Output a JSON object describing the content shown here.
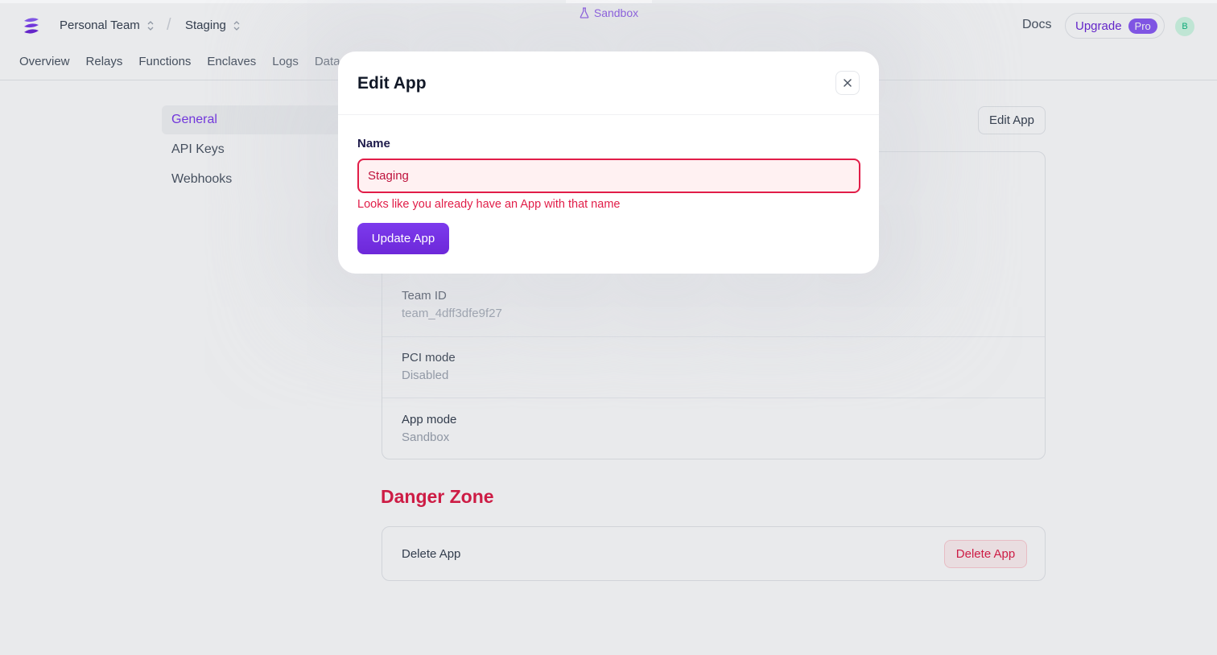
{
  "environment": {
    "label": "Sandbox",
    "icon": "flask-icon"
  },
  "header": {
    "team": "Personal Team",
    "app": "Staging",
    "docs": "Docs",
    "upgrade": "Upgrade",
    "plan_badge": "Pro",
    "avatar_initial": "B"
  },
  "tabs": [
    "Overview",
    "Relays",
    "Functions",
    "Enclaves",
    "Logs",
    "Data"
  ],
  "sidebar": {
    "items": [
      {
        "label": "General",
        "active": true
      },
      {
        "label": "API Keys",
        "active": false
      },
      {
        "label": "Webhooks",
        "active": false
      }
    ]
  },
  "main": {
    "edit_button": "Edit App",
    "fields": [
      {
        "label": "Team ID",
        "value": "team_4dff3dfe9f27"
      },
      {
        "label": "PCI mode",
        "value": "Disabled"
      },
      {
        "label": "App mode",
        "value": "Sandbox"
      }
    ]
  },
  "danger_zone": {
    "title": "Danger Zone",
    "delete_label": "Delete App",
    "delete_button": "Delete App"
  },
  "modal": {
    "title": "Edit App",
    "name_label": "Name",
    "name_value": "Staging",
    "error": "Looks like you already have an App with that name",
    "submit": "Update App",
    "close_icon": "close-icon"
  },
  "colors": {
    "accent": "#7c3aed",
    "error": "#e11d48",
    "error_bg": "#fff1f2"
  }
}
